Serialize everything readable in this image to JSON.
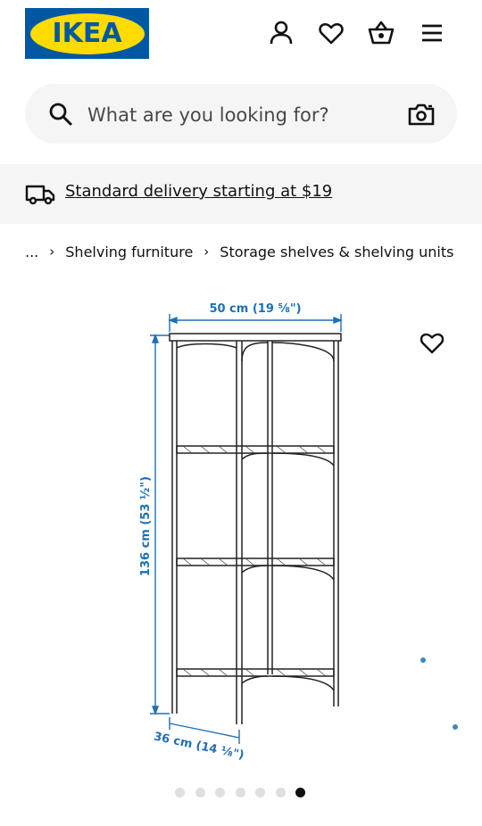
{
  "header": {
    "logo_text": "IKEA",
    "brand_colors": {
      "blue": "#0058a3",
      "yellow": "#ffdb00"
    },
    "icons": [
      "user-icon",
      "heart-icon",
      "shopping-bag-icon",
      "menu-icon"
    ]
  },
  "search": {
    "placeholder": "What are you looking for?",
    "icons": [
      "search-icon",
      "camera-icon"
    ]
  },
  "delivery": {
    "icon": "truck-icon",
    "link_text": "Standard delivery starting at $19"
  },
  "breadcrumb": {
    "ellipsis": "...",
    "items": [
      "Shelving furniture",
      "Storage shelves & shelving units"
    ]
  },
  "product_image": {
    "dim_width": "50 cm (19 ⅝\")",
    "dim_height": "136 cm (53 ½\")",
    "dim_depth": "36 cm (14 ⅛\")",
    "dim_color": "#1f6fb3"
  },
  "carousel": {
    "total": 7,
    "active_index": 6
  }
}
